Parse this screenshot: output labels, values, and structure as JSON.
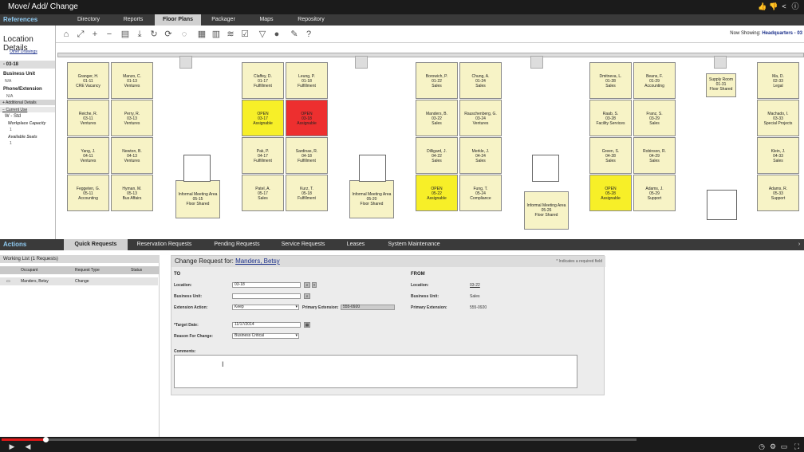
{
  "video": {
    "title": "Move/ Add/ Change"
  },
  "tabs": {
    "section_label": "References",
    "items": [
      {
        "label": "Directory",
        "active": false
      },
      {
        "label": "Reports",
        "active": false
      },
      {
        "label": "Floor Plans",
        "active": true
      },
      {
        "label": "Packager",
        "active": false
      },
      {
        "label": "Maps",
        "active": false
      },
      {
        "label": "Repository",
        "active": false
      }
    ]
  },
  "toolbar": {
    "icons": [
      "home-icon",
      "expand-icon",
      "zoom-in-icon",
      "zoom-out-icon",
      "print-icon",
      "download-icon",
      "refresh-icon",
      "rotate-icon",
      "reset-icon",
      "layers-icon",
      "database-icon",
      "stack-icon",
      "checkbox-icon",
      "filter-icon",
      "person-icon",
      "wrench-icon",
      "help-icon"
    ],
    "now_showing_label": "Now Showing:",
    "now_showing_value": "Headquarters - 03"
  },
  "left_panel": {
    "title": "Location Details",
    "other_drawings": "Other Drawings",
    "location": "- 03-18",
    "business_unit_label": "Business Unit",
    "business_unit_value": "N/A",
    "phone_label": "Phone/Extension",
    "phone_value": "N/A",
    "additional_details": "Additional Details",
    "current_use": "Current Use",
    "use_value": "W - Std",
    "workplace_capacity_label": "Workplace Capacity",
    "workplace_capacity_value": "1",
    "available_seats_label": "Available Seats",
    "available_seats_value": "1"
  },
  "floor_plan": {
    "rooms": [
      {
        "name": "Granger, H.",
        "id": "01-11",
        "dept": "CRE Vacancy",
        "status": "normal"
      },
      {
        "name": "Manzo, C.",
        "id": "01-13",
        "dept": "Ventures",
        "status": "normal"
      },
      {
        "name": "Reiche, R.",
        "id": "03-11",
        "dept": "Ventures",
        "status": "normal"
      },
      {
        "name": "Perry, R.",
        "id": "03-13",
        "dept": "Ventures",
        "status": "normal"
      },
      {
        "name": "Yang, J.",
        "id": "04-11",
        "dept": "Ventures",
        "status": "normal"
      },
      {
        "name": "Newton, B.",
        "id": "04-13",
        "dept": "Ventures",
        "status": "normal"
      },
      {
        "name": "Feggeten, G.",
        "id": "05-11",
        "dept": "Accounting",
        "status": "normal"
      },
      {
        "name": "Hyman, M.",
        "id": "05-13",
        "dept": "Bus Affairs",
        "status": "normal"
      },
      {
        "name": "Claffey, D.",
        "id": "01-17",
        "dept": "Fulfillment",
        "status": "normal"
      },
      {
        "name": "Leung, P.",
        "id": "01-18",
        "dept": "Fulfillment",
        "status": "normal"
      },
      {
        "name": "OPEN",
        "id": "03-17",
        "dept": "Assignable",
        "status": "open"
      },
      {
        "name": "OPEN",
        "id": "03-18",
        "dept": "Assignable",
        "status": "selected"
      },
      {
        "name": "Pak, P.",
        "id": "04-17",
        "dept": "Fulfillment",
        "status": "normal"
      },
      {
        "name": "Sardinas, R.",
        "id": "04-18",
        "dept": "Fulfillment",
        "status": "normal"
      },
      {
        "name": "Patel, A.",
        "id": "05-17",
        "dept": "Sales",
        "status": "normal"
      },
      {
        "name": "Kurz, T.",
        "id": "05-18",
        "dept": "Fulfillment",
        "status": "normal"
      },
      {
        "name": "Borowich, P.",
        "id": "01-22",
        "dept": "Sales",
        "status": "normal"
      },
      {
        "name": "Chung, A.",
        "id": "01-24",
        "dept": "Sales",
        "status": "normal"
      },
      {
        "name": "Manders, B.",
        "id": "03-22",
        "dept": "Sales",
        "status": "normal"
      },
      {
        "name": "Rauschenberg, G.",
        "id": "03-24",
        "dept": "Ventures",
        "status": "normal"
      },
      {
        "name": "Dilligard, J.",
        "id": "04-22",
        "dept": "Sales",
        "status": "normal"
      },
      {
        "name": "Merkle, J.",
        "id": "04-24",
        "dept": "Sales",
        "status": "normal"
      },
      {
        "name": "OPEN",
        "id": "05-22",
        "dept": "Assignable",
        "status": "open"
      },
      {
        "name": "Fung, T.",
        "id": "05-24",
        "dept": "Compliance",
        "status": "normal"
      },
      {
        "name": "Dmitneva, L.",
        "id": "01-28",
        "dept": "Sales",
        "status": "normal"
      },
      {
        "name": "Beans, F.",
        "id": "01-29",
        "dept": "Accounting",
        "status": "normal"
      },
      {
        "name": "Raab, S.",
        "id": "03-28",
        "dept": "Facility Services",
        "status": "normal"
      },
      {
        "name": "Franz, S.",
        "id": "03-29",
        "dept": "Sales",
        "status": "normal"
      },
      {
        "name": "Green, S.",
        "id": "04-28",
        "dept": "Sales",
        "status": "normal"
      },
      {
        "name": "Robinson, R.",
        "id": "04-29",
        "dept": "Sales",
        "status": "normal"
      },
      {
        "name": "OPEN",
        "id": "05-28",
        "dept": "Assignable",
        "status": "open"
      },
      {
        "name": "Adams, J.",
        "id": "05-29",
        "dept": "Support",
        "status": "normal"
      },
      {
        "name": "Ma, D.",
        "id": "02-33",
        "dept": "Legal",
        "status": "normal"
      },
      {
        "name": "Machado, I.",
        "id": "03-33",
        "dept": "Special Projects",
        "status": "normal"
      },
      {
        "name": "Klein, J.",
        "id": "04-33",
        "dept": "Sales",
        "status": "normal"
      },
      {
        "name": "Adams, R.",
        "id": "05-33",
        "dept": "Support",
        "status": "normal"
      }
    ],
    "meeting_areas": [
      {
        "name": "Informal Meeting Area",
        "id": "05-15",
        "dept": "Floor Shared"
      },
      {
        "name": "Informal Meeting Area",
        "id": "05-20",
        "dept": "Floor Shared"
      },
      {
        "name": "Informal Meeting Area",
        "id": "05-26",
        "dept": "Floor Shared"
      },
      {
        "name": "Supply Room",
        "id": "01-31",
        "dept": "Floor Shared"
      }
    ]
  },
  "actions": {
    "section_label": "Actions",
    "tabs": [
      {
        "label": "Quick Requests",
        "active": true
      },
      {
        "label": "Reservation Requests",
        "active": false
      },
      {
        "label": "Pending Requests",
        "active": false
      },
      {
        "label": "Service Requests",
        "active": false
      },
      {
        "label": "Leases",
        "active": false
      },
      {
        "label": "System Maintenance",
        "active": false
      }
    ]
  },
  "working_list": {
    "title": "Working List (1 Requests)",
    "columns": [
      "Occupant",
      "Request Type",
      "Status"
    ],
    "rows": [
      {
        "occupant": "Manders, Betsy",
        "type": "Change",
        "status": ""
      }
    ]
  },
  "form": {
    "title": "Change Request for:",
    "person": "Manders, Betsy",
    "required_note": "* Indicates a required field",
    "to_label": "TO",
    "from_label": "FROM",
    "location_label": "Location:",
    "location_value": "03-18",
    "business_unit_label": "Business Unit:",
    "business_unit_value": "",
    "extension_action_label": "Extension Action:",
    "extension_action_value": "Keep",
    "primary_extension_label": "Primary Extension:",
    "primary_extension_value": "555-0920",
    "target_date_label": "*Target Date:",
    "target_date_value": "11/17/2014",
    "reason_label": "Reason For Change:",
    "reason_value": "Business Critical",
    "comments_label": "Comments:",
    "comments_value": "",
    "from_location_label": "Location:",
    "from_location_value": "03-22",
    "from_business_unit_label": "Business Unit:",
    "from_business_unit_value": "Sales",
    "from_primary_extension_label": "Primary Extension:",
    "from_primary_extension_value": "555-0920"
  },
  "player": {
    "progress_fraction": 0.07
  }
}
